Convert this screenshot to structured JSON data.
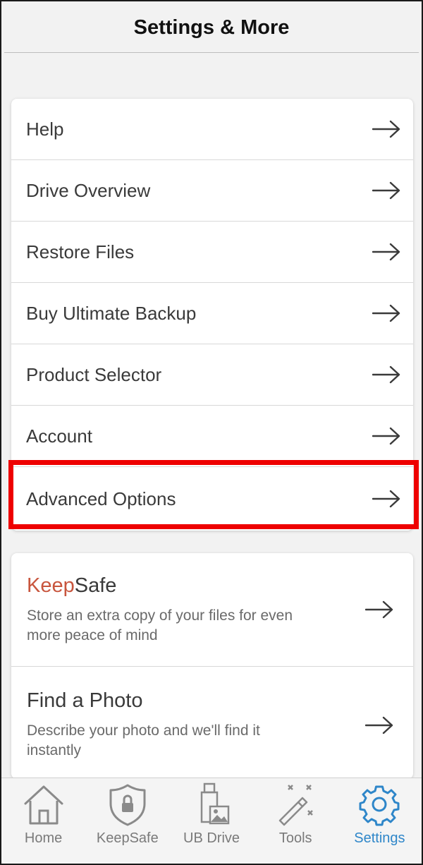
{
  "header": {
    "title": "Settings & More"
  },
  "menu": {
    "items": [
      {
        "label": "Help"
      },
      {
        "label": "Drive Overview"
      },
      {
        "label": "Restore Files"
      },
      {
        "label": "Buy Ultimate Backup"
      },
      {
        "label": "Product Selector"
      },
      {
        "label": "Account"
      },
      {
        "label": "Advanced Options"
      }
    ]
  },
  "features": {
    "keepsafe": {
      "title_part1": "Keep",
      "title_part2": "Safe",
      "description": "Store an extra copy of your files for even more peace of mind"
    },
    "find_photo": {
      "title": "Find a Photo",
      "description": "Describe your photo and we'll find it instantly"
    }
  },
  "tabbar": {
    "tabs": [
      {
        "label": "Home",
        "icon": "home-icon"
      },
      {
        "label": "KeepSafe",
        "icon": "shield-lock-icon"
      },
      {
        "label": "UB Drive",
        "icon": "usb-drive-icon"
      },
      {
        "label": "Tools",
        "icon": "magic-wand-icon"
      },
      {
        "label": "Settings",
        "icon": "gear-icon"
      }
    ],
    "active_tab": "Settings"
  },
  "colors": {
    "accent": "#2e86c9",
    "highlight": "#ee0000",
    "keepsafe_red": "#c8553d"
  }
}
